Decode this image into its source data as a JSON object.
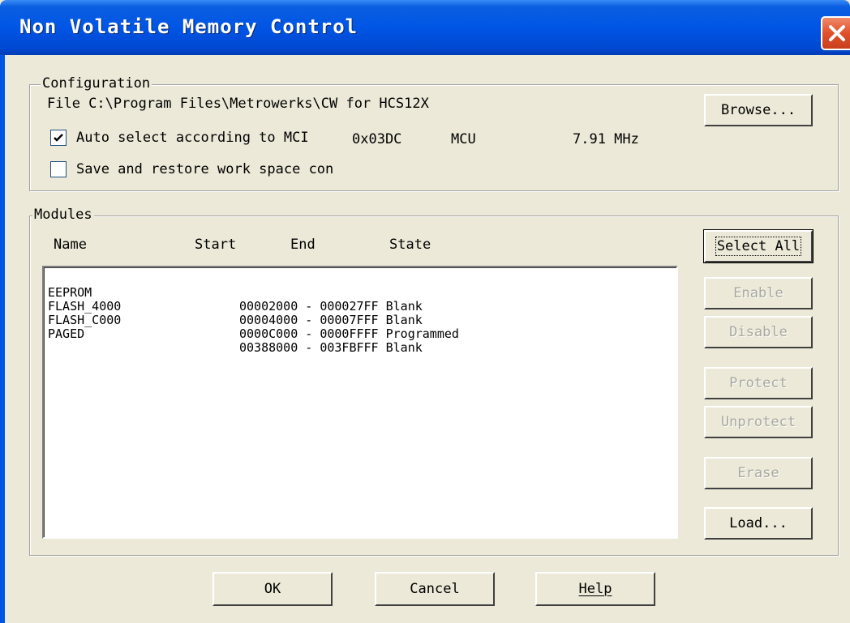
{
  "window": {
    "title": "Non Volatile Memory Control"
  },
  "configuration": {
    "legend": "Configuration",
    "file_label": "Filе C:\\Program Files\\Metrowerks\\CW for HCS12X",
    "browse_label": "Browse...",
    "auto_select": {
      "label": "Auto select according to MCI",
      "checked": true
    },
    "mcu_id": "0x03DC",
    "mcu_label": "MCU",
    "frequency": "7.91 MHz",
    "save_restore": {
      "label": "Save and restore work space con",
      "checked": false
    }
  },
  "modules": {
    "legend": "Modules",
    "columns": [
      "Name",
      "Start",
      "End",
      "State"
    ],
    "rows": [
      {
        "name": "EEPROM",
        "range": "00002000 - 000027FF Blank"
      },
      {
        "name": "FLASH_4000",
        "range": "00004000 - 00007FFF Blank"
      },
      {
        "name": "FLASH_C000",
        "range": "0000C000 - 0000FFFF Programmed"
      },
      {
        "name": "PAGED",
        "range": "00388000 - 003FBFFF Blank"
      }
    ],
    "buttons": {
      "select_all": "Select All",
      "enable": "Enable",
      "disable": "Disable",
      "protect": "Protect",
      "unprotect": "Unprotect",
      "erase": "Erase",
      "load": "Load..."
    }
  },
  "footer": {
    "ok": "OK",
    "cancel": "Cancel",
    "help": "Help"
  }
}
